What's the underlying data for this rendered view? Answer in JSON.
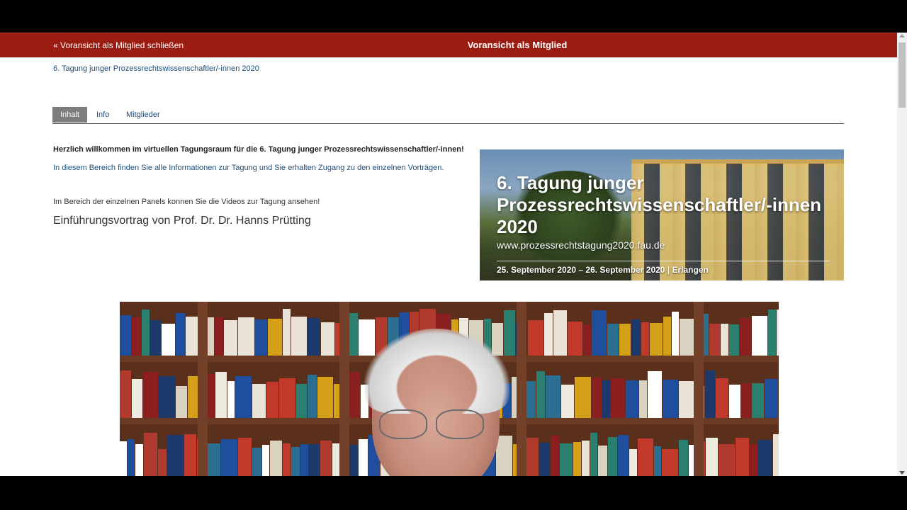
{
  "topbar": {
    "close_label": "« Voransicht als Mitglied schließen",
    "title": "Voransicht als Mitglied",
    "color": "#9b1c10"
  },
  "breadcrumb": "6. Tagung junger Prozessrechtswissenschaftler/-innen 2020",
  "tabs": [
    {
      "label": "Inhalt",
      "active": true
    },
    {
      "label": "Info",
      "active": false
    },
    {
      "label": "Mitglieder",
      "active": false
    }
  ],
  "content": {
    "welcome": "Herzlich willkommen im virtuellen Tagungsraum für die 6. Tagung junger Prozessrechtswissenschaftler/-innen!",
    "intro": "In diesem Bereich finden Sie alle Informationen zur Tagung und Sie erhalten Zugang zu den einzelnen Vorträgen.",
    "panels_note": "Im Bereich der einzelnen Panels konnen Sie die Videos zur Tagung ansehen!",
    "lecture_heading": "Einführungsvortrag von Prof. Dr. Dr. Hanns Prütting"
  },
  "banner": {
    "title": "6. Tagung junger Prozessrechtswissenschaftler/-innen 2020",
    "url": "www.prozessrechtstagung2020.fau.de",
    "dates": "25. September 2020 – 26. September 2020 | Erlangen"
  },
  "video": {
    "description": "video-frame"
  }
}
